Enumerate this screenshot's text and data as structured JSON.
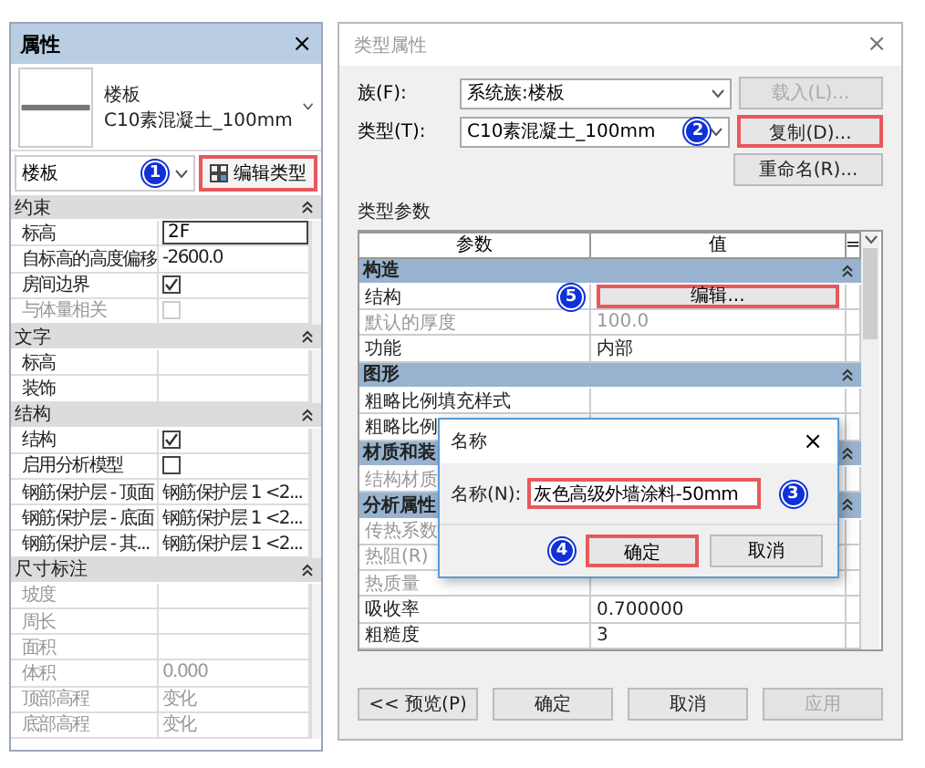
{
  "properties_panel": {
    "title": "属性",
    "close": "×",
    "preview": {
      "category": "楼板",
      "type": "C10素混凝土_100mm"
    },
    "selector": {
      "value": "楼板",
      "callout": "1"
    },
    "edit_type_button": {
      "label": "编辑类型",
      "highlighted": true
    },
    "groups": [
      {
        "title": "约束",
        "rows": [
          {
            "label": "标高",
            "kind": "input",
            "value": "2F",
            "disabled": false
          },
          {
            "label": "自标高的高度偏移",
            "kind": "text",
            "value": "-2600.0",
            "disabled": false
          },
          {
            "label": "房间边界",
            "kind": "checkbox",
            "checked": true,
            "disabled": false
          },
          {
            "label": "与体量相关",
            "kind": "checkbox",
            "checked": false,
            "disabled": true
          }
        ]
      },
      {
        "title": "文字",
        "rows": [
          {
            "label": "标高",
            "kind": "text",
            "disabled": false
          },
          {
            "label": "装饰",
            "kind": "text",
            "disabled": false
          }
        ]
      },
      {
        "title": "结构",
        "rows": [
          {
            "label": "结构",
            "kind": "checkbox",
            "checked": true,
            "disabled": false
          },
          {
            "label": "启用分析模型",
            "kind": "checkbox",
            "checked": false,
            "disabled": false
          },
          {
            "label": "钢筋保护层 - 顶面",
            "kind": "text",
            "value": "钢筋保护层 1 <2...",
            "disabled": false
          },
          {
            "label": "钢筋保护层 - 底面",
            "kind": "text",
            "value": "钢筋保护层 1 <2...",
            "disabled": false
          },
          {
            "label": "钢筋保护层 - 其...",
            "kind": "text",
            "value": "钢筋保护层 1 <2...",
            "disabled": false
          }
        ]
      },
      {
        "title": "尺寸标注",
        "rows": [
          {
            "label": "坡度",
            "kind": "text",
            "disabled": true
          },
          {
            "label": "周长",
            "kind": "text",
            "disabled": true
          },
          {
            "label": "面积",
            "kind": "text",
            "disabled": true
          },
          {
            "label": "体积",
            "kind": "text",
            "value": "0.000",
            "disabled": true
          },
          {
            "label": "顶部高程",
            "kind": "text",
            "value": "变化",
            "disabled": true
          },
          {
            "label": "底部高程",
            "kind": "text",
            "value": "变化",
            "disabled": true
          }
        ]
      }
    ]
  },
  "type_dialog": {
    "title": "类型属性",
    "close": "×",
    "family": {
      "label": "族(F):",
      "value": "系统族:楼板"
    },
    "type": {
      "label": "类型(T):",
      "value": "C10素混凝土_100mm",
      "callout": "2"
    },
    "side_buttons": [
      {
        "label": "载入(L)...",
        "disabled": true,
        "highlighted": false
      },
      {
        "label": "复制(D)...",
        "disabled": false,
        "highlighted": true
      },
      {
        "label": "重命名(R)...",
        "disabled": false,
        "highlighted": false
      }
    ],
    "params_title": "类型参数",
    "columns": [
      "参数",
      "值",
      "="
    ],
    "groups": [
      {
        "title": "构造",
        "rows": [
          {
            "label": "结构",
            "kind": "button",
            "value": "编辑...",
            "highlighted": true,
            "callout": "5",
            "disabled": false
          },
          {
            "label": "默认的厚度",
            "kind": "text",
            "value": "100.0",
            "disabled": true
          },
          {
            "label": "功能",
            "kind": "text",
            "value": "内部",
            "disabled": false
          }
        ]
      },
      {
        "title": "图形",
        "rows": [
          {
            "label": "粗略比例填充样式",
            "kind": "text",
            "disabled": false
          },
          {
            "label": "粗略比例",
            "kind": "text",
            "disabled": false
          }
        ]
      },
      {
        "title": "材质和装",
        "rows": [
          {
            "label": "结构材质",
            "kind": "text",
            "disabled": true
          }
        ]
      },
      {
        "title": "分析属性",
        "rows": [
          {
            "label": "传热系数",
            "kind": "text",
            "disabled": true
          },
          {
            "label": "热阻(R)",
            "kind": "text",
            "disabled": true
          },
          {
            "label": "热质量",
            "kind": "text",
            "disabled": true
          },
          {
            "label": "吸收率",
            "kind": "text",
            "value": "0.700000",
            "disabled": false
          },
          {
            "label": "粗糙度",
            "kind": "text",
            "value": "3",
            "disabled": false
          }
        ]
      }
    ],
    "footer_buttons": [
      {
        "label": "<< 预览(P)",
        "disabled": false
      },
      {
        "label": "确定",
        "disabled": false
      },
      {
        "label": "取消",
        "disabled": false
      },
      {
        "label": "应用",
        "disabled": true
      }
    ]
  },
  "name_dialog": {
    "title": "名称",
    "close": "×",
    "label": "名称(N):",
    "value": "灰色高级外墙涂料-50mm",
    "highlighted": true,
    "callout": "3",
    "buttons": [
      {
        "label": "确定",
        "default": true,
        "highlighted": true,
        "callout": "4"
      },
      {
        "label": "取消",
        "default": false,
        "highlighted": false
      }
    ]
  }
}
